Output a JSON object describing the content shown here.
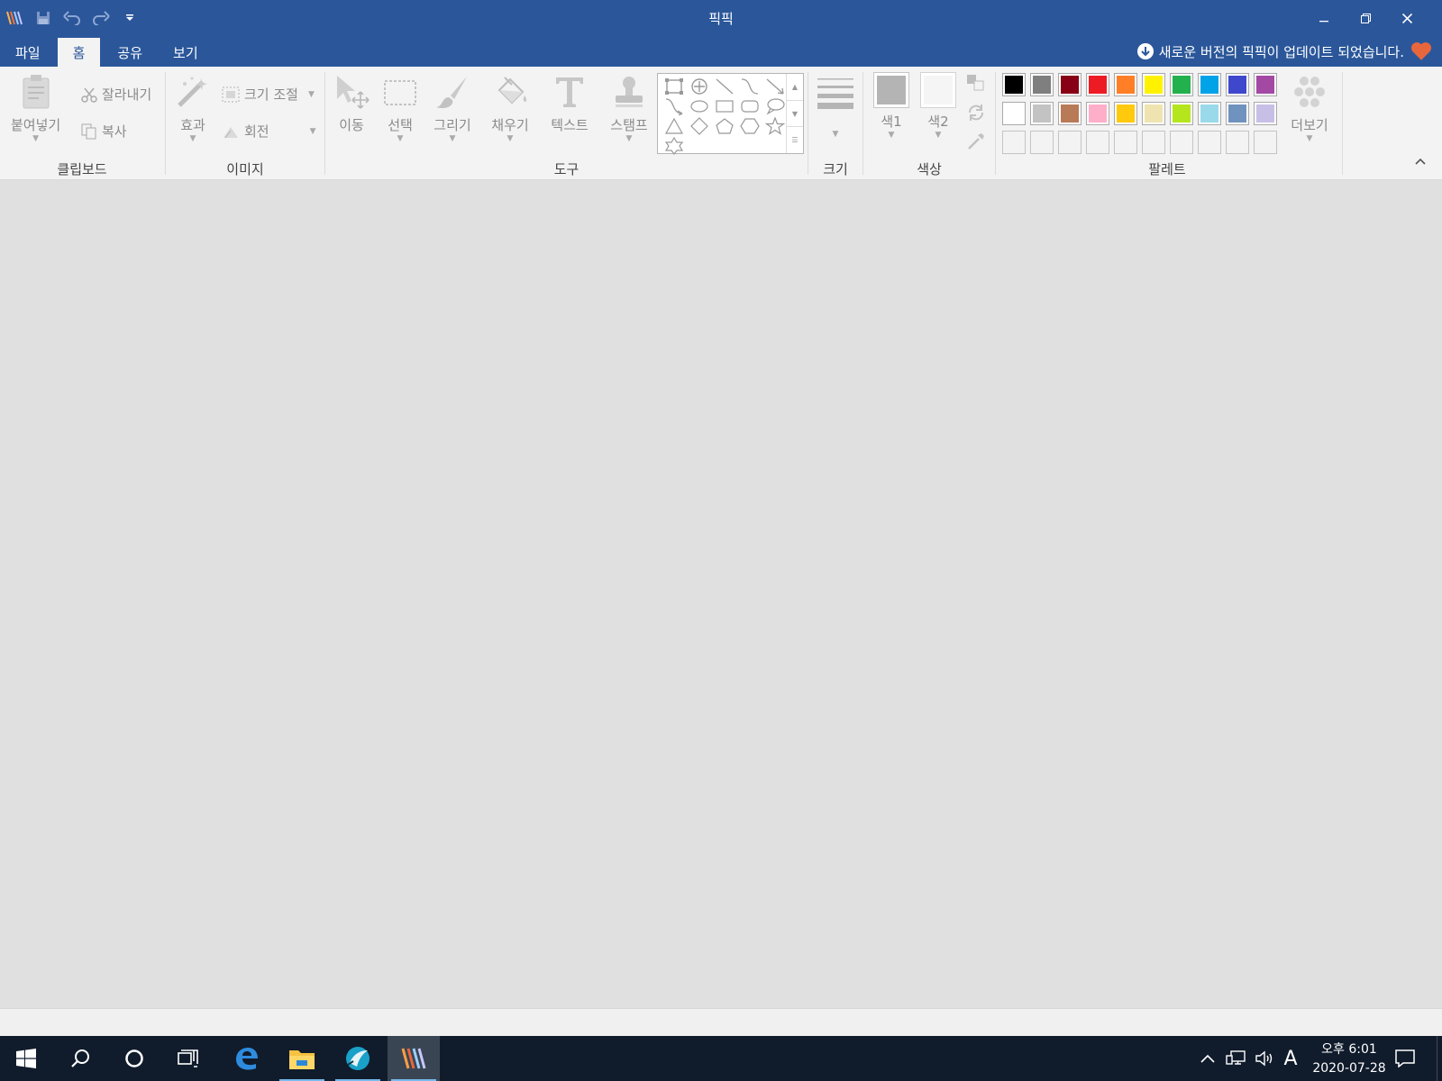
{
  "window": {
    "title": "픽픽",
    "minimize_icon": "minimize-icon",
    "restore_icon": "restore-icon",
    "close_icon": "close-icon"
  },
  "quick_access": [
    "app-logo-icon",
    "save-icon",
    "undo-icon",
    "redo-icon",
    "customize-dropdown-icon"
  ],
  "tabs": [
    {
      "label": "파일",
      "active": false
    },
    {
      "label": "홈",
      "active": true
    },
    {
      "label": "공유",
      "active": false
    },
    {
      "label": "보기",
      "active": false
    }
  ],
  "update_notice": {
    "text": "새로운 버전의 픽픽이 업데이트 되었습니다.",
    "icon": "download-arrow-icon"
  },
  "ribbon": {
    "clipboard": {
      "group_label": "클립보드",
      "paste": "붙여넣기",
      "cut": "잘라내기",
      "copy": "복사"
    },
    "image": {
      "group_label": "이미지",
      "effects": "효과",
      "resize": "크기 조절",
      "rotate": "회전"
    },
    "tools": {
      "group_label": "도구",
      "move": "이동",
      "select": "선택",
      "draw": "그리기",
      "fill": "채우기",
      "text": "텍스트",
      "stamp": "스탬프"
    },
    "size": {
      "group_label": "크기"
    },
    "color": {
      "group_label": "색상",
      "color1": "색1",
      "color2": "색2",
      "color1_value": "#b4b4b4",
      "color2_value": "#f5f5f5"
    },
    "palette": {
      "group_label": "팔레트",
      "more": "더보기",
      "row1": [
        "#000000",
        "#7f7f7f",
        "#880015",
        "#ed1c24",
        "#ff7f27",
        "#fff200",
        "#22b14c",
        "#00a2e8",
        "#3f48cc",
        "#a349a4"
      ],
      "row2": [
        "#ffffff",
        "#c3c3c3",
        "#b97a57",
        "#ffaec9",
        "#ffc90e",
        "#efe4b0",
        "#b5e61d",
        "#99d9ea",
        "#7092be",
        "#c8bfe7"
      ]
    }
  },
  "shapes": [
    "select-rect-shape",
    "crosshair-shape",
    "line-shape",
    "curve-shape",
    "arrow-shape",
    "curved-arrow-shape",
    "ellipse-shape",
    "rectangle-shape",
    "rounded-rectangle-shape",
    "speech-bubble-shape",
    "triangle-shape",
    "diamond-shape",
    "pentagon-shape",
    "hexagon-shape",
    "star-shape",
    "six-point-star-shape"
  ],
  "taskbar": {
    "apps": [
      "start-icon",
      "search-icon",
      "cortana-icon",
      "task-view-icon",
      "edge-icon",
      "file-explorer-icon",
      "swordfish-app-icon",
      "picpick-icon"
    ],
    "ime": "A",
    "time": "오후 6:01",
    "date": "2020-07-28"
  }
}
